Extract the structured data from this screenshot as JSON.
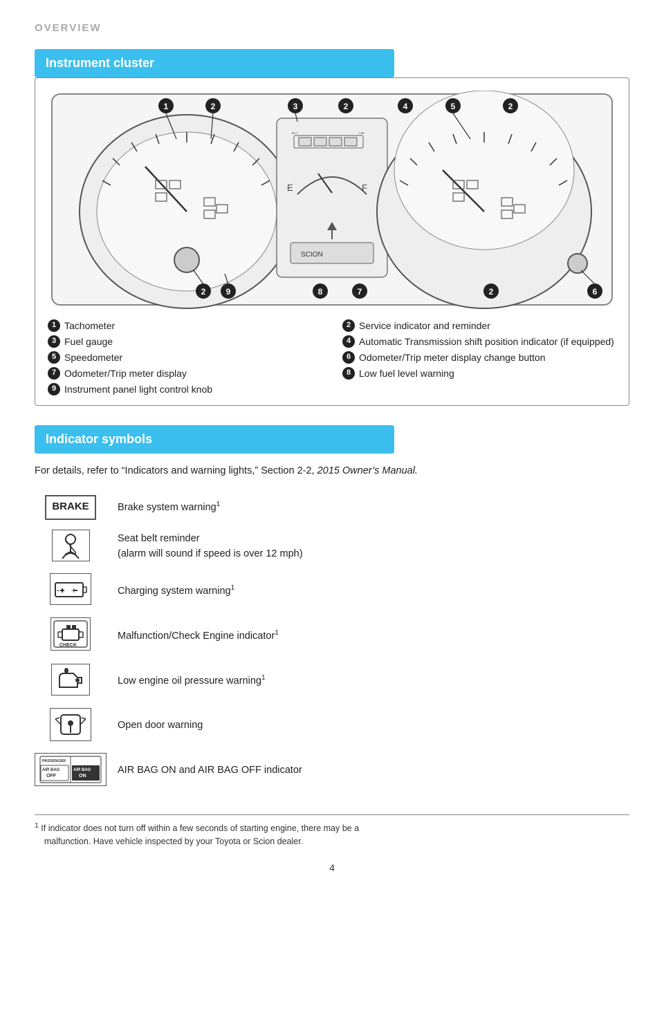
{
  "page": {
    "title": "OVERVIEW",
    "page_number": "4"
  },
  "instrument_cluster": {
    "header": "Instrument cluster",
    "legend": [
      {
        "num": "1",
        "text": "Tachometer"
      },
      {
        "num": "2",
        "text": "Service indicator and reminder"
      },
      {
        "num": "3",
        "text": "Fuel gauge"
      },
      {
        "num": "4",
        "text": "Automatic Transmission shift position indicator (if equipped)"
      },
      {
        "num": "5",
        "text": "Speedometer"
      },
      {
        "num": "6",
        "text": "Odometer/Trip meter display change button"
      },
      {
        "num": "7",
        "text": "Odometer/Trip meter display"
      },
      {
        "num": "8",
        "text": "Low fuel level warning"
      },
      {
        "num": "9",
        "text": "Instrument panel light control knob"
      }
    ]
  },
  "indicator_symbols": {
    "header": "Indicator symbols",
    "intro_text": "For details, refer to “Indicators and warning lights,” Section 2-2,",
    "intro_italic": "2015  Owner’s Manual.",
    "indicators": [
      {
        "icon_type": "brake",
        "icon_label": "BRAKE",
        "text": "Brake system warning",
        "superscript": "1"
      },
      {
        "icon_type": "seatbelt",
        "icon_label": "seatbelt",
        "text": "Seat belt reminder\n(alarm will sound if speed is over 12 mph)",
        "superscript": ""
      },
      {
        "icon_type": "battery",
        "icon_label": "battery",
        "text": "Charging system warning",
        "superscript": "1"
      },
      {
        "icon_type": "check",
        "icon_label": "CHECK",
        "text": "Malfunction/Check Engine indicator",
        "superscript": "1"
      },
      {
        "icon_type": "oil",
        "icon_label": "oil",
        "text": "Low engine oil pressure warning",
        "superscript": "1"
      },
      {
        "icon_type": "door",
        "icon_label": "door",
        "text": "Open door warning",
        "superscript": ""
      },
      {
        "icon_type": "airbag",
        "icon_label": "airbag",
        "text": "AIR BAG ON and AIR BAG OFF indicator",
        "superscript": ""
      }
    ]
  },
  "footnote": {
    "superscript": "1",
    "text": "If indicator does not turn off within a few seconds of starting engine, there may be a\n   malfunction. Have vehicle inspected by your Toyota or Scion dealer."
  }
}
